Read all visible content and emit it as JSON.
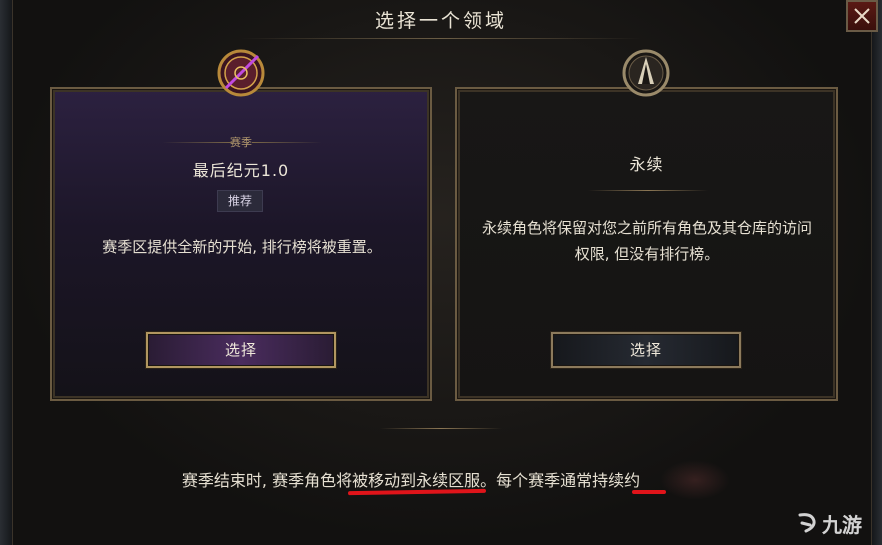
{
  "dialog": {
    "title": "选择一个领域",
    "close_icon": "close-icon"
  },
  "realms": [
    {
      "id": "season",
      "emblem_icon": "season-emblem-icon",
      "tag": "赛季",
      "name": "最后纪元1.0",
      "badge": "推荐",
      "description": "赛季区提供全新的开始, 排行榜将被重置。",
      "select_label": "选择",
      "accent": "#4a2c5e"
    },
    {
      "id": "eternal",
      "emblem_icon": "eternal-emblem-icon",
      "name": "永续",
      "description": "永续角色将保留对您之前所有角色及其仓库的访问权限, 但没有排行榜。",
      "select_label": "选择",
      "accent": "#262a32"
    }
  ],
  "footer": {
    "part1": "赛季结束时, 赛季角色将被",
    "part2": "移动到永续区服",
    "part3": "。每个赛季通常持续约"
  },
  "annotation_color": "#e0141a",
  "watermark": {
    "text": "九游",
    "icon": "jiuyou-logo-icon"
  }
}
